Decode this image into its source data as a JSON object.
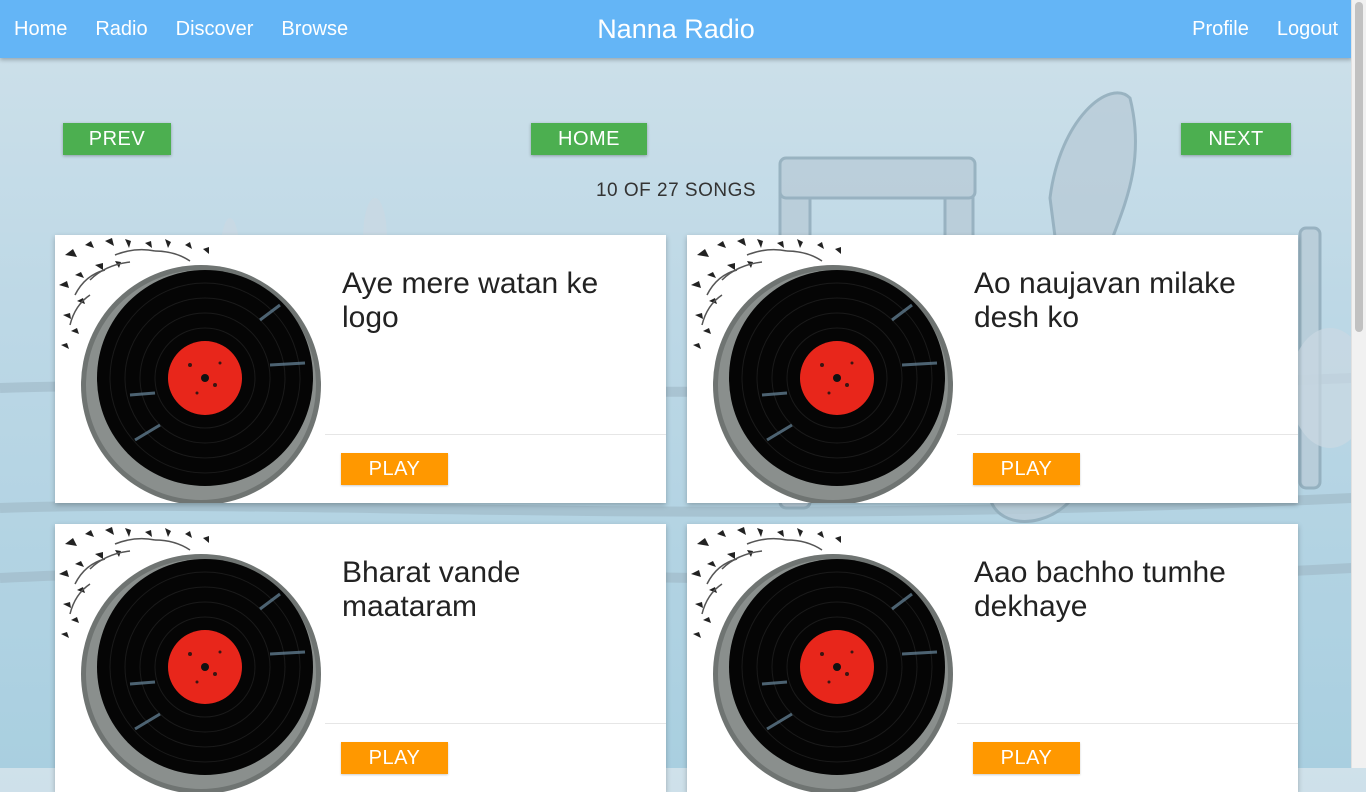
{
  "nav": {
    "left": [
      {
        "label": "Home"
      },
      {
        "label": "Radio"
      },
      {
        "label": "Discover"
      },
      {
        "label": "Browse"
      }
    ],
    "brand": "Nanna Radio",
    "right": [
      {
        "label": "Profile"
      },
      {
        "label": "Logout"
      }
    ]
  },
  "pager": {
    "prev": "PREV",
    "home": "HOME",
    "next": "NEXT",
    "count": "10 OF 27 SONGS"
  },
  "songs": [
    {
      "title": "Aye mere watan ke logo",
      "play": "PLAY"
    },
    {
      "title": "Ao naujavan milake desh ko",
      "play": "PLAY"
    },
    {
      "title": "Bharat vande maataram",
      "play": "PLAY"
    },
    {
      "title": "Aao bachho tumhe dekhaye",
      "play": "PLAY"
    }
  ],
  "colors": {
    "navbar": "#64b5f6",
    "pager_button": "#4caf50",
    "play_button": "#ff9800",
    "record_label": "#e8261b"
  }
}
